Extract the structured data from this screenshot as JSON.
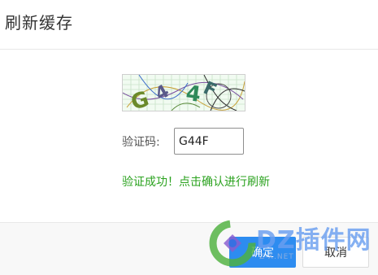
{
  "dialog": {
    "title": "刷新缓存",
    "captcha": {
      "text": "G44F"
    },
    "code_label": "验证码:",
    "code_value": "G44F",
    "success_message": "验证成功！点击确认进行刷新",
    "confirm_label": "确定",
    "cancel_label": "取消"
  },
  "watermark": {
    "text": "DZ插件网",
    "subtext": "Z-X.NET"
  },
  "colors": {
    "success": "#2aa21e",
    "primary": "#2d8cf0"
  }
}
